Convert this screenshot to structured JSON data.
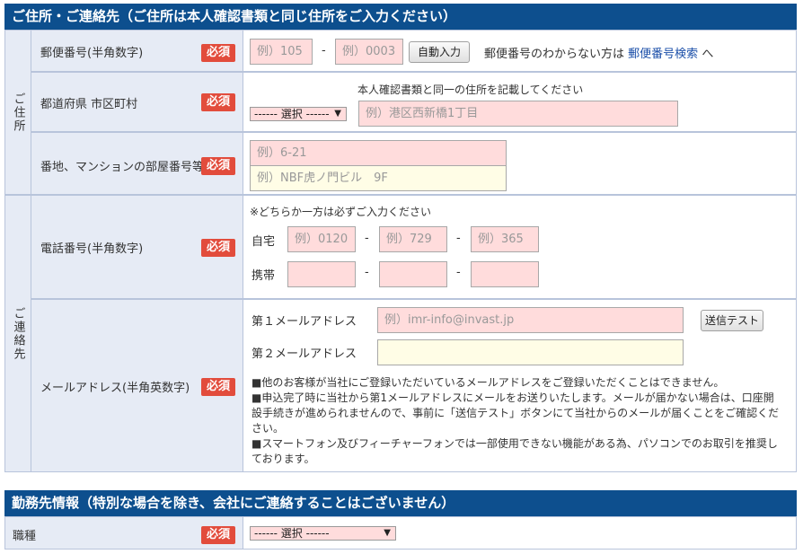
{
  "address_section": {
    "title": "ご住所・ご連絡先（ご住所は本人確認書類と同じ住所をご入力ください）",
    "group_label": "ご住所",
    "required_label": "必須",
    "postal": {
      "label": "郵便番号(半角数字)",
      "part1_placeholder": "例）105",
      "part2_placeholder": "例）0003",
      "dash": "-",
      "auto_button": "自動入力",
      "help_prefix": "郵便番号のわからない方は",
      "help_link": "郵便番号検索",
      "help_suffix": "へ"
    },
    "prefecture": {
      "label": "都道府県 市区町村",
      "note": "本人確認書類と同一の住所を記載してください",
      "select_value": "------ 選択 ------",
      "city_placeholder": "例）港区西新橋1丁目"
    },
    "street": {
      "label": "番地、マンションの部屋番号等",
      "line1_placeholder": "例）6-21",
      "line2_placeholder": "例）NBF虎ノ門ビル　9F"
    }
  },
  "contact_section": {
    "group_label": "ご連絡先",
    "phone": {
      "label": "電話番号(半角数字)",
      "note": "※どちらか一方は必ずご入力ください",
      "home_label": "自宅",
      "home_p1": "例）0120",
      "home_p2": "例）729",
      "home_p3": "例）365",
      "mobile_label": "携帯",
      "dash": "-"
    },
    "email": {
      "label": "メールアドレス(半角英数字)",
      "first_label": "第１メールアドレス",
      "first_placeholder": "例）imr-info@invast.jp",
      "test_button": "送信テスト",
      "second_label": "第２メールアドレス",
      "notes": [
        "■他のお客様が当社にご登録いただいているメールアドレスをご登録いただくことはできません。",
        "■申込完了時に当社から第1メールアドレスにメールをお送りいたします。メールが届かない場合は、口座開",
        "設手続きが進められませんので、事前に「送信テスト」ボタンにて当社からのメールが届くことをご確認くだ",
        "さい。",
        "■スマートフォン及びフィーチャーフォンでは一部使用できない機能がある為、パソコンでのお取引を推奨し",
        "ております。"
      ]
    }
  },
  "work_section": {
    "title": "勤務先情報（特別な場合を除き、会社にご連絡することはございません）",
    "occupation_label": "職種",
    "select_value": "------ 選択 ------"
  },
  "colors": {
    "header_bg": "#0d4f8e",
    "label_bg": "#e6ebf5",
    "required_bg": "#e24c3c",
    "input_pink": "#ffdcdc",
    "input_yellow": "#fffde6",
    "link": "#1a4ea8"
  },
  "icons": {
    "select_arrow": "dropdown-arrow-icon"
  }
}
